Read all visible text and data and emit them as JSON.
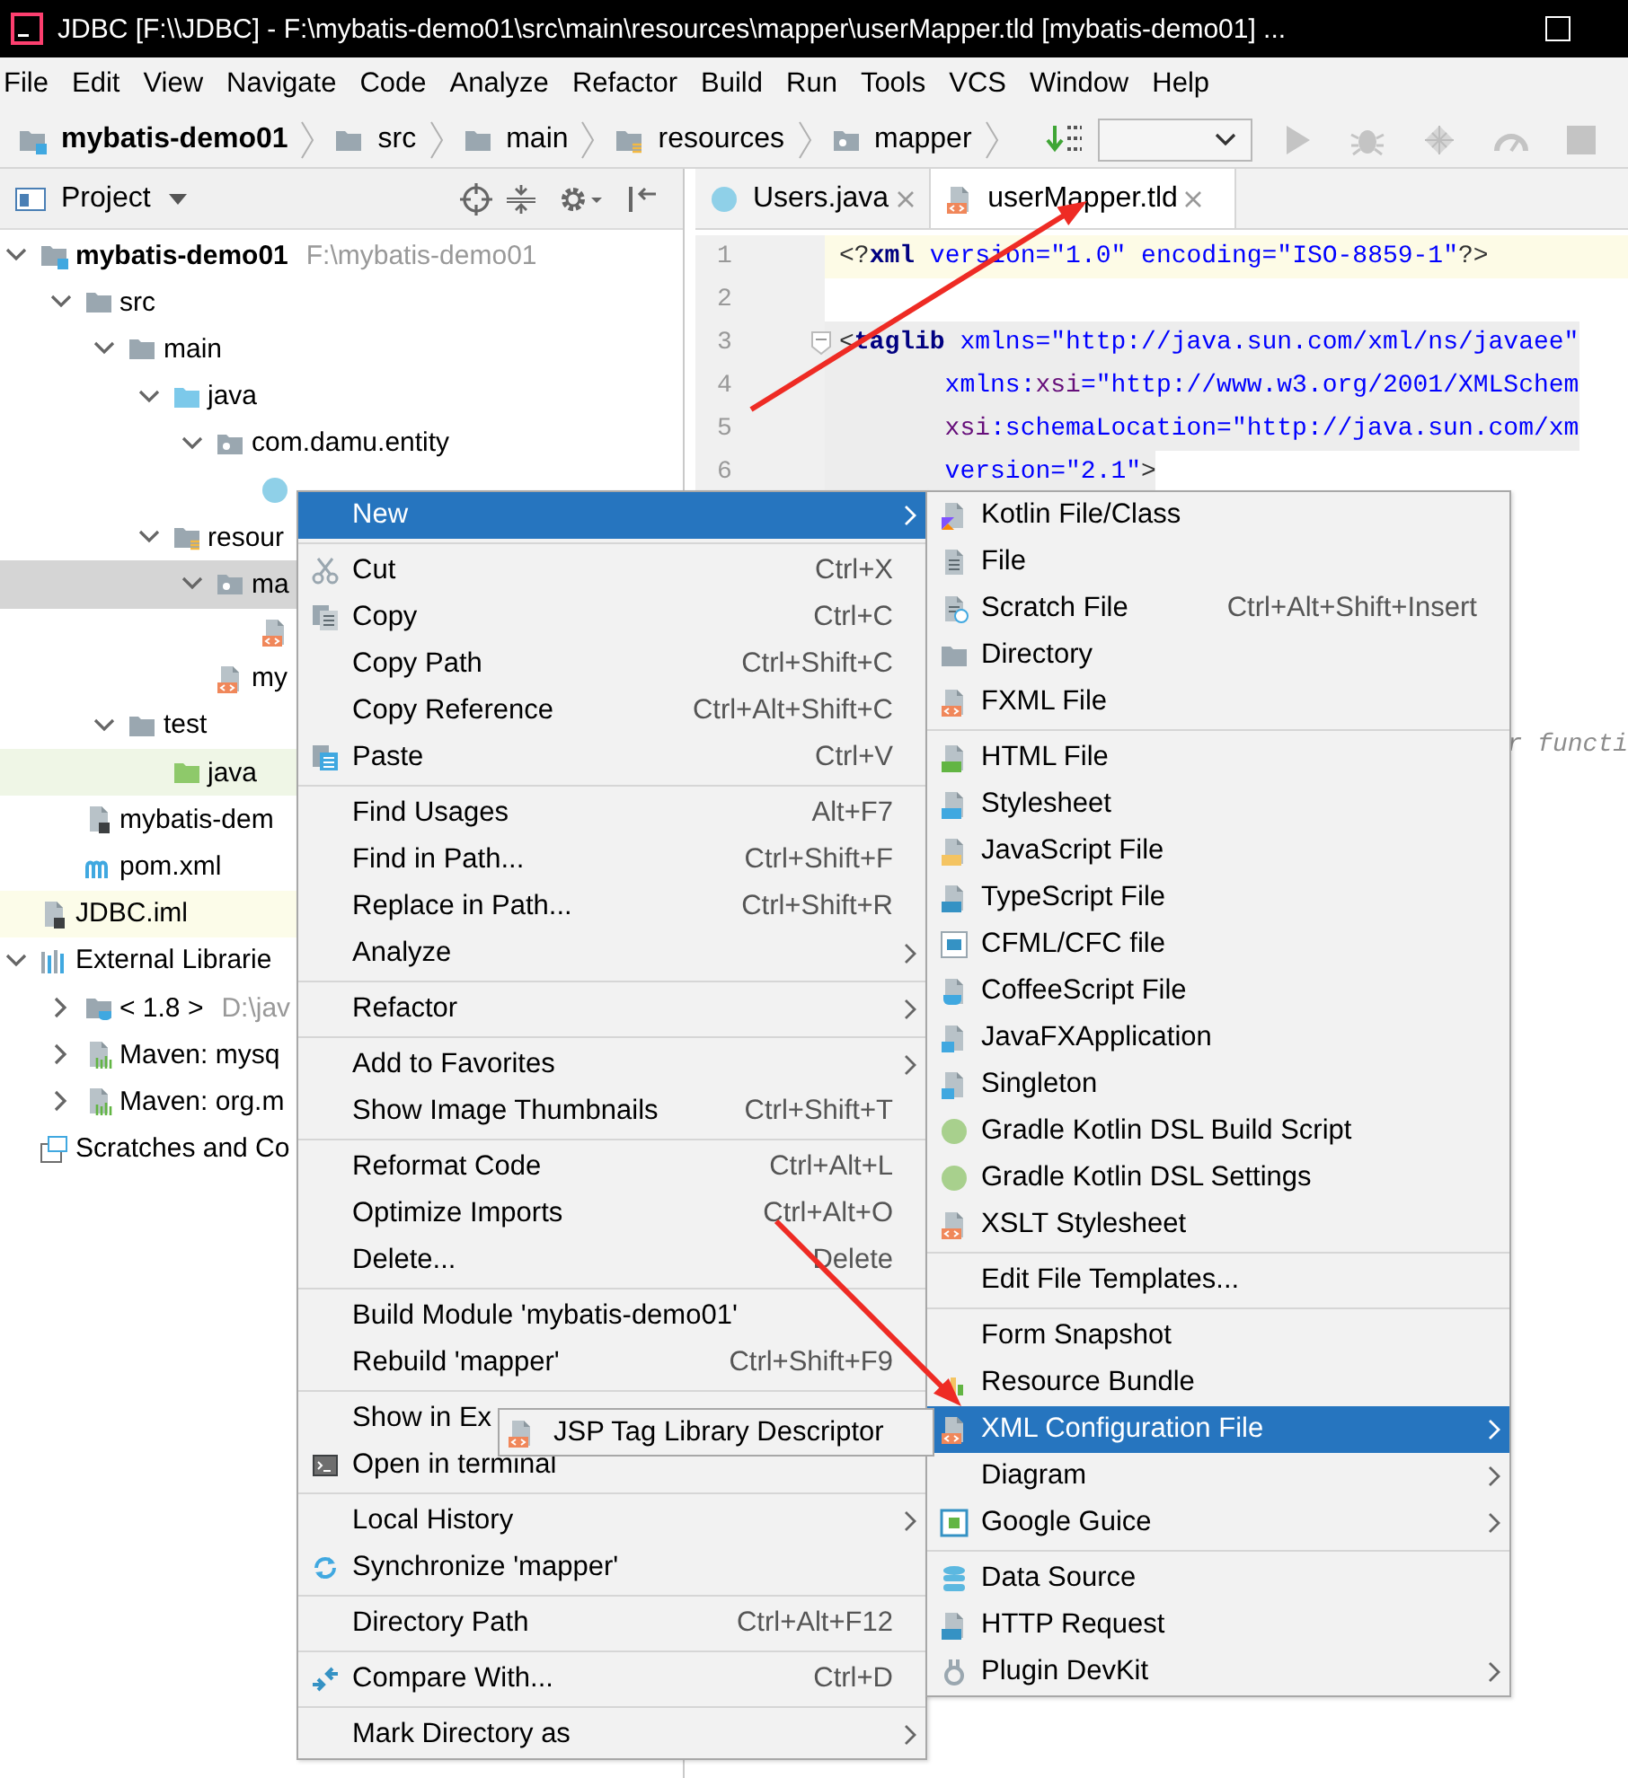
{
  "window": {
    "title": "JDBC [F:\\\\JDBC] - F:\\mybatis-demo01\\src\\main\\resources\\mapper\\userMapper.tld [mybatis-demo01] ..."
  },
  "menu_bar": [
    "File",
    "Edit",
    "View",
    "Navigate",
    "Code",
    "Analyze",
    "Refactor",
    "Build",
    "Run",
    "Tools",
    "VCS",
    "Window",
    "Help"
  ],
  "breadcrumbs": [
    {
      "label": "mybatis-demo01",
      "kind": "module"
    },
    {
      "label": "src",
      "kind": "folder"
    },
    {
      "label": "main",
      "kind": "folder"
    },
    {
      "label": "resources",
      "kind": "resources"
    },
    {
      "label": "mapper",
      "kind": "package"
    }
  ],
  "project_panel": {
    "title": "Project",
    "tree": [
      {
        "label": "mybatis-demo01",
        "note": "F:\\mybatis-demo01",
        "kind": "module",
        "expanded": true,
        "selected": false,
        "children": [
          {
            "label": "src",
            "kind": "folder",
            "expanded": true,
            "selected": false,
            "children": [
              {
                "label": "main",
                "kind": "folder",
                "expanded": true,
                "selected": false,
                "children": [
                  {
                    "label": "java",
                    "kind": "folder-source",
                    "expanded": true,
                    "selected": false,
                    "children": [
                      {
                        "label": "com.damu.entity",
                        "kind": "package",
                        "expanded": true,
                        "selected": false,
                        "children": [
                          {
                            "kind": "class",
                            "selected": false
                          }
                        ]
                      }
                    ]
                  },
                  {
                    "label": "resour",
                    "kind": "resources",
                    "expanded": true,
                    "selected": false,
                    "children": [
                      {
                        "label": "ma",
                        "kind": "package",
                        "expanded": true,
                        "selected": true,
                        "children": [
                          {
                            "kind": "xml",
                            "selected": false
                          }
                        ]
                      },
                      {
                        "label": "my",
                        "kind": "xml",
                        "selected": false
                      }
                    ]
                  }
                ]
              },
              {
                "label": "test",
                "kind": "folder",
                "expanded": true,
                "selected": false,
                "children": [
                  {
                    "label": "java",
                    "kind": "folder-test",
                    "selected": false,
                    "color": "#eff6e6"
                  }
                ]
              }
            ]
          },
          {
            "label": "mybatis-dem",
            "kind": "iml",
            "selected": false
          },
          {
            "label": "pom.xml",
            "kind": "maven",
            "selected": false
          }
        ]
      },
      {
        "label": "JDBC.iml",
        "kind": "iml",
        "selected": false,
        "color": "#fcfce9"
      },
      {
        "label": "External Librarie",
        "kind": "libraries",
        "expanded": true,
        "selected": false,
        "children": [
          {
            "label": "< 1.8 >",
            "note": "D:\\jav",
            "kind": "jdk",
            "expanded": false,
            "selected": false
          },
          {
            "label": "Maven: mysq",
            "kind": "maven-lib",
            "expanded": false,
            "selected": false
          },
          {
            "label": "Maven: org.m",
            "kind": "maven-lib",
            "expanded": false,
            "selected": false
          }
        ]
      },
      {
        "label": "Scratches and Co",
        "kind": "scratches",
        "selected": false
      }
    ]
  },
  "editor": {
    "tabs": [
      {
        "label": "Users.java",
        "kind": "class",
        "selected": false
      },
      {
        "label": "userMapper.tld",
        "kind": "xml",
        "selected": true
      }
    ],
    "lines": [
      {
        "number": "1",
        "kind": "caret-line",
        "foldable": false,
        "tokens": [
          {
            "text": "<?",
            "kind": "bracket"
          },
          {
            "text": "xml",
            "kind": "tag"
          },
          {
            "text": " version=\"1.0\" encoding=\"ISO-8859-1\"",
            "kind": "attr"
          },
          {
            "text": "?>",
            "kind": "bracket"
          }
        ]
      },
      {
        "number": "2",
        "kind": "plain",
        "foldable": false
      },
      {
        "number": "3",
        "kind": "tag-range",
        "foldable": true,
        "tokens": [
          {
            "text": "<",
            "kind": "bracket"
          },
          {
            "text": "taglib",
            "kind": "tag"
          },
          {
            "text": " xmlns=\"http://java.sun.com/xml/ns/javaee\"",
            "kind": "attr"
          }
        ]
      },
      {
        "number": "4",
        "kind": "tag-range",
        "foldable": false,
        "tokens": [
          {
            "text": "       xmlns:",
            "kind": "attr"
          },
          {
            "text": "xsi",
            "kind": "ns"
          },
          {
            "text": "=\"http://www.w3.org/2001/XMLSchem",
            "kind": "attr"
          }
        ]
      },
      {
        "number": "5",
        "kind": "tag-range",
        "foldable": false,
        "tokens": [
          {
            "text": "       xsi",
            "kind": "ns"
          },
          {
            "text": ":schemaLocation=\"http://java.sun.com/xm",
            "kind": "attr"
          }
        ]
      },
      {
        "number": "6",
        "kind": "tag-range",
        "foldable": false,
        "tokens": [
          {
            "text": "       version=\"2.1\"",
            "kind": "attr"
          },
          {
            "text": ">",
            "kind": "bracket"
          }
        ]
      }
    ],
    "comment_fragment": "r functi"
  },
  "context_menu": {
    "groups": [
      [
        {
          "label": "New",
          "selected": true,
          "submenu": true
        }
      ],
      [
        {
          "label": "Cut",
          "kind": "cut",
          "shortcut": "Ctrl+X",
          "selected": false,
          "submenu": false
        },
        {
          "label": "Copy",
          "kind": "copy",
          "shortcut": "Ctrl+C",
          "selected": false,
          "submenu": false
        },
        {
          "label": "Copy Path",
          "shortcut": "Ctrl+Shift+C",
          "selected": false,
          "submenu": false
        },
        {
          "label": "Copy Reference",
          "shortcut": "Ctrl+Alt+Shift+C",
          "selected": false,
          "submenu": false
        },
        {
          "label": "Paste",
          "kind": "paste",
          "shortcut": "Ctrl+V",
          "selected": false,
          "submenu": false
        }
      ],
      [
        {
          "label": "Find Usages",
          "shortcut": "Alt+F7",
          "selected": false,
          "submenu": false
        },
        {
          "label": "Find in Path...",
          "shortcut": "Ctrl+Shift+F",
          "selected": false,
          "submenu": false
        },
        {
          "label": "Replace in Path...",
          "shortcut": "Ctrl+Shift+R",
          "selected": false,
          "submenu": false
        },
        {
          "label": "Analyze",
          "selected": false,
          "submenu": true
        }
      ],
      [
        {
          "label": "Refactor",
          "selected": false,
          "submenu": true
        }
      ],
      [
        {
          "label": "Add to Favorites",
          "selected": false,
          "submenu": true
        },
        {
          "label": "Show Image Thumbnails",
          "shortcut": "Ctrl+Shift+T",
          "selected": false,
          "submenu": false
        }
      ],
      [
        {
          "label": "Reformat Code",
          "shortcut": "Ctrl+Alt+L",
          "selected": false,
          "submenu": false
        },
        {
          "label": "Optimize Imports",
          "shortcut": "Ctrl+Alt+O",
          "selected": false,
          "submenu": false
        },
        {
          "label": "Delete...",
          "shortcut": "Delete",
          "selected": false,
          "submenu": false
        }
      ],
      [
        {
          "label": "Build Module 'mybatis-demo01'",
          "selected": false,
          "submenu": false
        },
        {
          "label": "Rebuild 'mapper'",
          "shortcut": "Ctrl+Shift+F9",
          "selected": false,
          "submenu": false
        }
      ],
      [
        {
          "label": "Show in Ex",
          "selected": false,
          "submenu": false
        },
        {
          "label": "Open in terminal",
          "kind": "terminal",
          "selected": false,
          "submenu": false
        }
      ],
      [
        {
          "label": "Local History",
          "selected": false,
          "submenu": true
        },
        {
          "label": "Synchronize 'mapper'",
          "kind": "sync",
          "selected": false,
          "submenu": false
        }
      ],
      [
        {
          "label": "Directory Path",
          "shortcut": "Ctrl+Alt+F12",
          "selected": false,
          "submenu": false
        }
      ],
      [
        {
          "label": "Compare With...",
          "kind": "compare",
          "shortcut": "Ctrl+D",
          "selected": false,
          "submenu": false
        }
      ],
      [
        {
          "label": "Mark Directory as",
          "selected": false,
          "submenu": true
        }
      ]
    ]
  },
  "new_submenu": {
    "groups": [
      [
        {
          "label": "Kotlin File/Class",
          "kind": "kotlin",
          "selected": false,
          "submenu": false
        },
        {
          "label": "File",
          "kind": "file",
          "selected": false,
          "submenu": false
        },
        {
          "label": "Scratch File",
          "kind": "scratch",
          "shortcut": "Ctrl+Alt+Shift+Insert",
          "selected": false,
          "submenu": false
        },
        {
          "label": "Directory",
          "kind": "directory",
          "selected": false,
          "submenu": false
        },
        {
          "label": "FXML File",
          "kind": "xml",
          "selected": false,
          "submenu": false
        }
      ],
      [
        {
          "label": "HTML File",
          "kind": "html",
          "selected": false,
          "submenu": false
        },
        {
          "label": "Stylesheet",
          "kind": "css",
          "selected": false,
          "submenu": false
        },
        {
          "label": "JavaScript File",
          "kind": "js",
          "selected": false,
          "submenu": false
        },
        {
          "label": "TypeScript File",
          "kind": "ts",
          "selected": false,
          "submenu": false
        },
        {
          "label": "CFML/CFC file",
          "kind": "cf",
          "selected": false,
          "submenu": false
        },
        {
          "label": "CoffeeScript File",
          "kind": "coffee",
          "selected": false,
          "submenu": false
        },
        {
          "label": "JavaFXApplication",
          "kind": "javaclass",
          "selected": false,
          "submenu": false
        },
        {
          "label": "Singleton",
          "kind": "javaclass",
          "selected": false,
          "submenu": false
        },
        {
          "label": "Gradle Kotlin DSL Build Script",
          "kind": "gradle",
          "selected": false,
          "submenu": false
        },
        {
          "label": "Gradle Kotlin DSL Settings",
          "kind": "gradle",
          "selected": false,
          "submenu": false
        },
        {
          "label": "XSLT Stylesheet",
          "kind": "xml",
          "selected": false,
          "submenu": false
        }
      ],
      [
        {
          "label": "Edit File Templates...",
          "selected": false,
          "submenu": false
        }
      ],
      [
        {
          "label": "Form Snapshot",
          "selected": false,
          "submenu": false
        },
        {
          "label": "Resource Bundle",
          "kind": "bundle",
          "selected": false,
          "submenu": false
        },
        {
          "label": "XML Configuration File",
          "kind": "xml",
          "selected": true,
          "submenu": true
        },
        {
          "label": "Diagram",
          "selected": false,
          "submenu": true
        },
        {
          "label": "Google Guice",
          "kind": "guice",
          "selected": false,
          "submenu": true
        }
      ],
      [
        {
          "label": "Data Source",
          "kind": "database",
          "selected": false,
          "submenu": false
        },
        {
          "label": "HTTP Request",
          "kind": "api",
          "selected": false,
          "submenu": false
        },
        {
          "label": "Plugin DevKit",
          "kind": "plugin",
          "selected": false,
          "submenu": true
        }
      ]
    ]
  },
  "xml_submenu": {
    "items": [
      {
        "label": "JSP Tag Library Descriptor",
        "kind": "xml"
      }
    ]
  }
}
